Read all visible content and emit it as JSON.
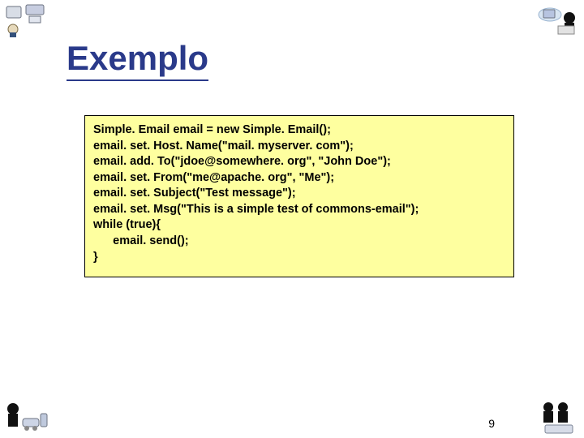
{
  "title": "Exemplo",
  "code": {
    "l1": "Simple. Email email = new Simple. Email();",
    "l2": "email. set. Host. Name(\"mail. myserver. com\");",
    "l3": "email. add. To(\"jdoe@somewhere. org\", \"John Doe\");",
    "l4": "email. set. From(\"me@apache. org\", \"Me\");",
    "l5": "email. set. Subject(\"Test message\");",
    "l6": "email. set. Msg(\"This is a simple test of commons-email\");",
    "l7": "while (true){",
    "l8": "      email. send();",
    "l9": "}"
  },
  "pageNumber": "9"
}
